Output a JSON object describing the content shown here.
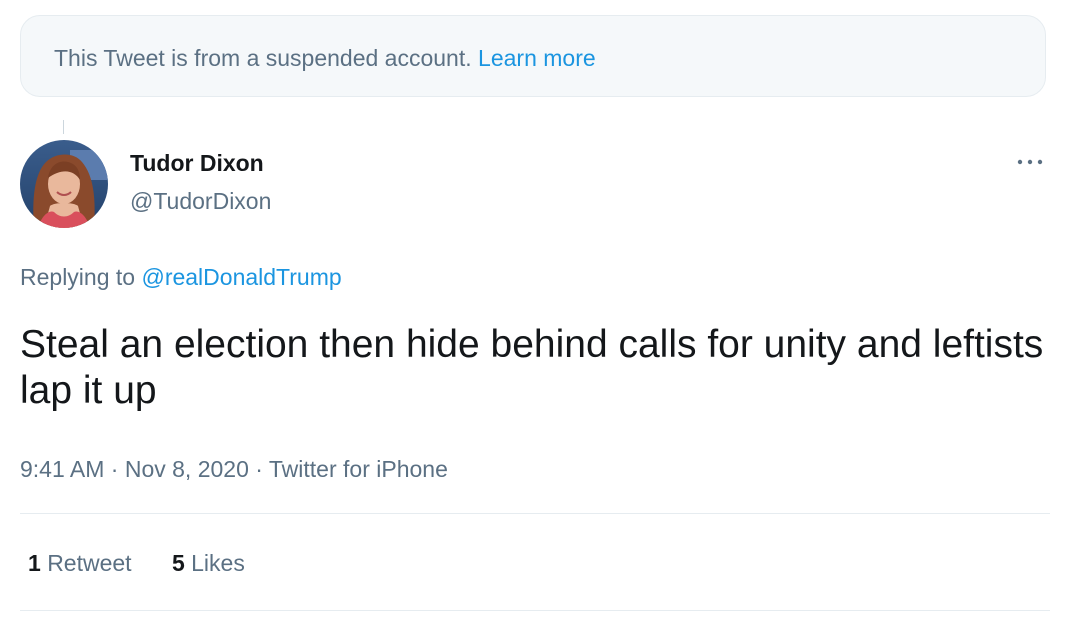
{
  "notice": {
    "text": "This Tweet is from a suspended account.",
    "link": "Learn more"
  },
  "author": {
    "name": "Tudor Dixon",
    "handle": "@TudorDixon",
    "avatar_icon": "profile-photo"
  },
  "reply": {
    "prefix": "Replying to",
    "mention": "@realDonaldTrump"
  },
  "tweet": {
    "text": "Steal an election then hide behind calls for unity and leftists lap it up"
  },
  "meta": {
    "time": "9:41 AM",
    "date": "Nov 8, 2020",
    "source": "Twitter for iPhone"
  },
  "stats": {
    "retweets_count": "1",
    "retweets_label": "Retweet",
    "likes_count": "5",
    "likes_label": "Likes"
  },
  "colors": {
    "link": "#1b95e0",
    "secondary_text": "#5b7083",
    "primary_text": "#14171a",
    "notice_bg": "#f5f8fa"
  }
}
